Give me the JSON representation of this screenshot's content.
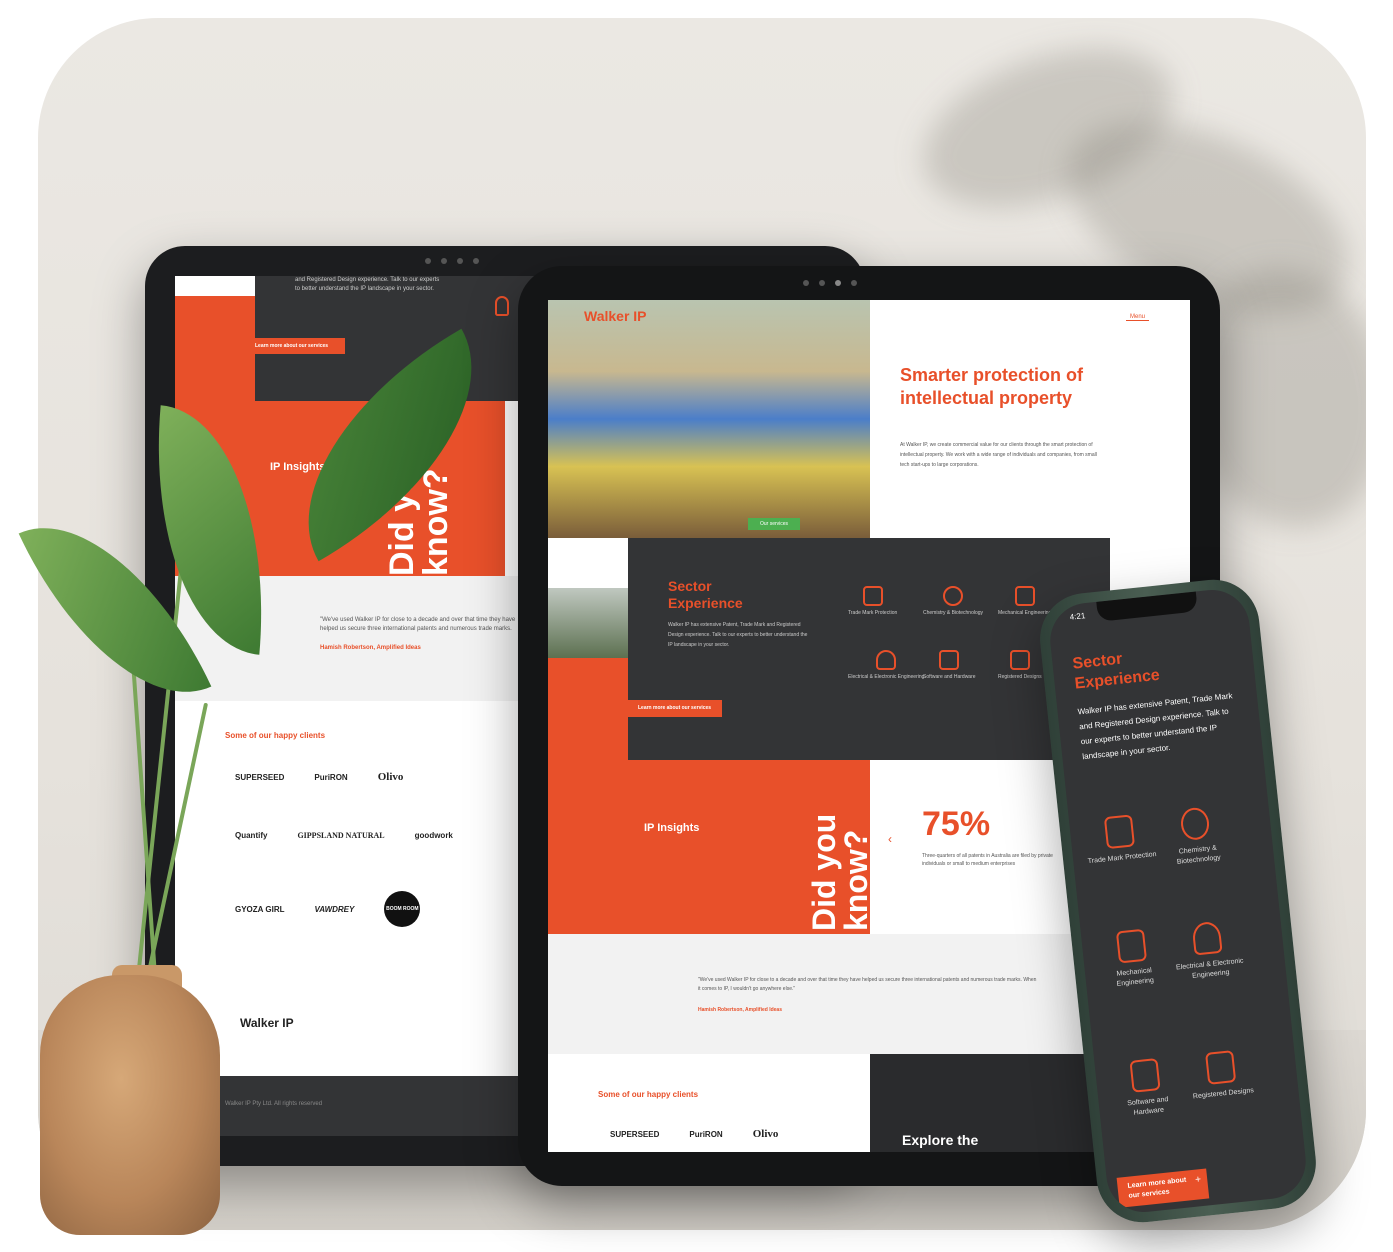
{
  "back_tablet": {
    "intro_text": "and Registered Design experience. Talk to our experts to better understand the IP landscape in your sector.",
    "button": "Learn more about our services",
    "icon_label": "Electrical & Electronic Engineering",
    "ip_insights": "IP Insights",
    "did_you_know": "Did you know?",
    "quote": "\"We've used Walker IP for close to a decade and over that time they have helped us secure three international patents and numerous trade marks. When it comes to IP, I wouldn't go anywhere else.\"",
    "quote_author": "Hamish Robertson, Amplified Ideas",
    "clients_heading": "Some of our happy clients",
    "clients": [
      "SUPERSEED",
      "PuriRON",
      "Olivo",
      "Quantify",
      "GIPPSLAND NATURAL",
      "goodwork",
      "GYOZA GIRL",
      "VAWDREY",
      "BOOM ROOM"
    ],
    "footer_logo": "Walker IP",
    "footer_text": "Walker IP Pty Ltd. All rights reserved"
  },
  "front_tablet": {
    "logo": "Walker IP",
    "menu": "Menu",
    "headline": "Smarter protection of intellectual property",
    "intro": "At Walker IP, we create commercial value for our clients through the smart protection of intellectual property. We work with a wide range of individuals and companies, from small tech start-ups to large corporations.",
    "hero_button": "Our services",
    "sector_title": "Sector Experience",
    "sector_text": "Walker IP has extensive Patent, Trade Mark and Registered Design experience. Talk to our experts to better understand the IP landscape in your sector.",
    "sector_button": "Learn more about our services",
    "sectors": [
      "Trade Mark Protection",
      "Chemistry & Biotechnology",
      "Mechanical Engineering",
      "Electrical & Electronic Engineering",
      "Software and Hardware",
      "Registered Designs"
    ],
    "ip_insights": "IP Insights",
    "did_you_know": "Did you know?",
    "stat": "75%",
    "stat_text": "Three-quarters of all patents in Australia are filed by private individuals or small to medium enterprises",
    "quote": "\"We've used Walker IP for close to a decade and over that time they have helped us secure three international patents and numerous trade marks. When it comes to IP, I wouldn't go anywhere else.\"",
    "quote_author": "Hamish Robertson, Amplified Ideas",
    "clients_heading": "Some of our happy clients",
    "clients": [
      "SUPERSEED",
      "PuriRON",
      "Olivo"
    ],
    "explore": "Explore the"
  },
  "phone": {
    "time": "4:21",
    "sector_title": "Sector Experience",
    "sector_text": "Walker IP has extensive Patent, Trade Mark and Registered Design experience. Talk to our experts to better understand the IP landscape in your sector.",
    "sectors": [
      "Trade Mark Protection",
      "Chemistry & Biotechnology",
      "Mechanical Engineering",
      "Electrical & Electronic Engineering",
      "Software and Hardware",
      "Registered Designs"
    ],
    "button": "Learn more about our services"
  },
  "colors": {
    "accent": "#e8502a",
    "dark": "#333436"
  }
}
